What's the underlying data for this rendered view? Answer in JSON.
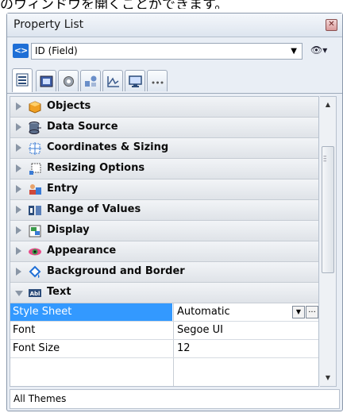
{
  "caption": "のウィンドウを開くことができます。",
  "panel": {
    "title": "Property List",
    "close_symbol": "✕",
    "selector": {
      "nav_icon": "<>",
      "value": "ID (Field)",
      "arrow": "▼",
      "eye_symbol": "👁▾"
    },
    "tabs": [
      {
        "icon": "list-icon"
      },
      {
        "icon": "object-icon"
      },
      {
        "icon": "gear-icon"
      },
      {
        "icon": "shapes-icon"
      },
      {
        "icon": "chart-icon"
      },
      {
        "icon": "monitor-icon"
      },
      {
        "icon": "more-icon"
      }
    ],
    "sections": [
      {
        "label": "Objects",
        "icon": "cube-icon",
        "expanded": false
      },
      {
        "label": "Data Source",
        "icon": "database-icon",
        "expanded": false
      },
      {
        "label": "Coordinates & Sizing",
        "icon": "coordinates-icon",
        "expanded": false
      },
      {
        "label": "Resizing Options",
        "icon": "resize-icon",
        "expanded": false
      },
      {
        "label": "Entry",
        "icon": "entry-icon",
        "expanded": false
      },
      {
        "label": "Range of Values",
        "icon": "range-icon",
        "expanded": false
      },
      {
        "label": "Display",
        "icon": "display-icon",
        "expanded": false
      },
      {
        "label": "Appearance",
        "icon": "eye-icon",
        "expanded": false
      },
      {
        "label": "Background and Border",
        "icon": "paint-bucket-icon",
        "expanded": false
      },
      {
        "label": "Text",
        "icon": "text-icon",
        "expanded": true
      }
    ],
    "properties": [
      {
        "name": "Style Sheet",
        "value": "Automatic",
        "selected": true
      },
      {
        "name": "Font",
        "value": "Segoe UI"
      },
      {
        "name": "Font Size",
        "value": "12"
      }
    ],
    "ellipsis": "...",
    "footer": "All Themes",
    "colors": {
      "selection": "#3399ff",
      "nav_icon_bg": "#1f6fd6"
    }
  }
}
